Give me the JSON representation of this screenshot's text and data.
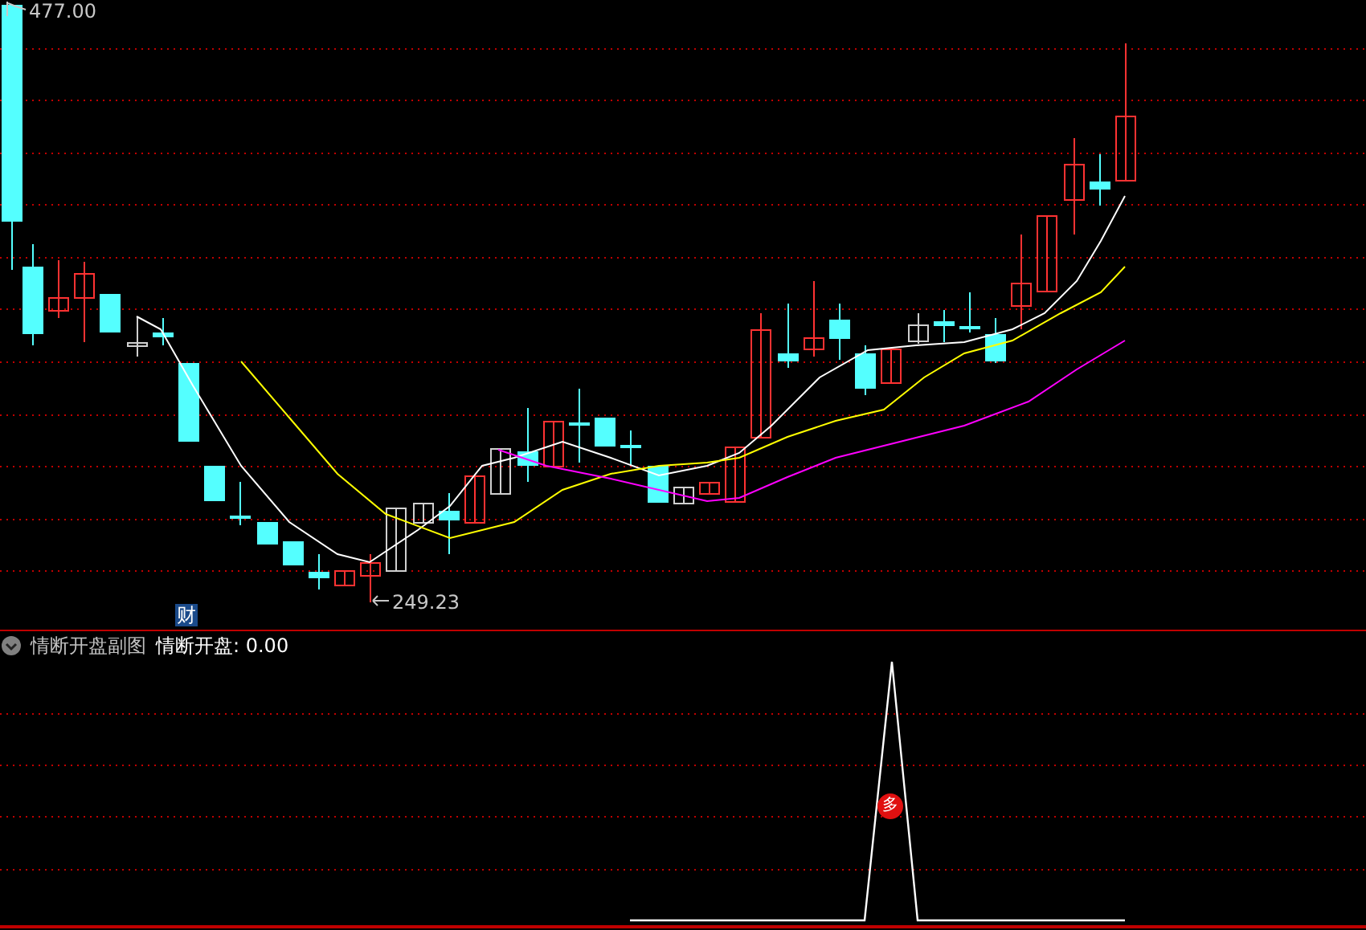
{
  "main_chart": {
    "high_label": "477.00",
    "low_label": "249.23",
    "finance_badge": "财"
  },
  "indicator_panel": {
    "title": "情断开盘副图",
    "reading": "情断开盘: 0.00",
    "signal_badge": "多"
  }
}
